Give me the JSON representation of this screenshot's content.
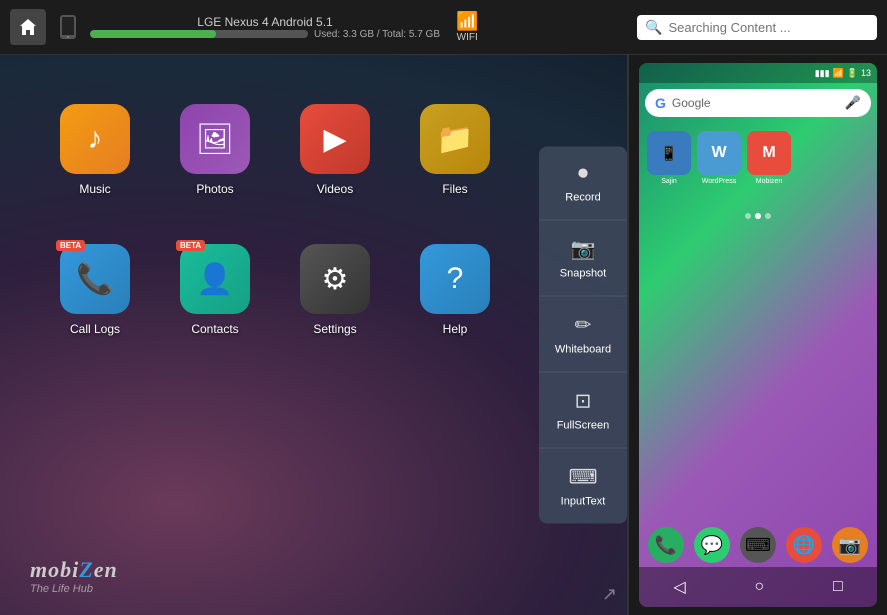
{
  "topbar": {
    "device_name": "LGE Nexus 4 Android 5.1",
    "storage_used": "Used: 3.3 GB / Total: 5.7 GB",
    "storage_percent": 58,
    "wifi_label": "WIFI",
    "search_placeholder": "Searching Content ..."
  },
  "apps": [
    {
      "id": "music",
      "label": "Music",
      "icon": "♪",
      "color_class": "icon-music",
      "beta": false
    },
    {
      "id": "photos",
      "label": "Photos",
      "icon": "🖼",
      "color_class": "icon-photos",
      "beta": false
    },
    {
      "id": "videos",
      "label": "Videos",
      "icon": "▶",
      "color_class": "icon-videos",
      "beta": false
    },
    {
      "id": "files",
      "label": "Files",
      "icon": "📁",
      "color_class": "icon-files",
      "beta": false
    },
    {
      "id": "calllogs",
      "label": "Call Logs",
      "icon": "📞",
      "color_class": "icon-calllogs",
      "beta": true
    },
    {
      "id": "contacts",
      "label": "Contacts",
      "icon": "👤",
      "color_class": "icon-contacts",
      "beta": true
    },
    {
      "id": "settings",
      "label": "Settings",
      "icon": "⚙",
      "color_class": "icon-settings",
      "beta": false
    },
    {
      "id": "help",
      "label": "Help",
      "icon": "?",
      "color_class": "icon-help",
      "beta": false
    }
  ],
  "toolbar": {
    "items": [
      {
        "id": "record",
        "label": "Record",
        "icon": "⏺"
      },
      {
        "id": "snapshot",
        "label": "Snapshot",
        "icon": "📷"
      },
      {
        "id": "whiteboard",
        "label": "Whiteboard",
        "icon": "✏"
      },
      {
        "id": "fullscreen",
        "label": "FullScreen",
        "icon": "⬜"
      },
      {
        "id": "inputtext",
        "label": "InputText",
        "icon": "⌨"
      }
    ]
  },
  "phone": {
    "google_placeholder": "Google",
    "apps": [
      {
        "id": "sajin",
        "label": "Sajin",
        "bg": "#3a7bbf",
        "icon": "📱"
      },
      {
        "id": "wordpress",
        "label": "WordPress",
        "bg": "#4a9bd4",
        "icon": "W"
      },
      {
        "id": "mobizen",
        "label": "Mobizen",
        "bg": "#e74c3c",
        "icon": "M"
      }
    ],
    "nav": [
      "◁",
      "○",
      "□"
    ]
  },
  "brand": {
    "logo": "mobiZen",
    "tagline": "The Life Hub"
  }
}
